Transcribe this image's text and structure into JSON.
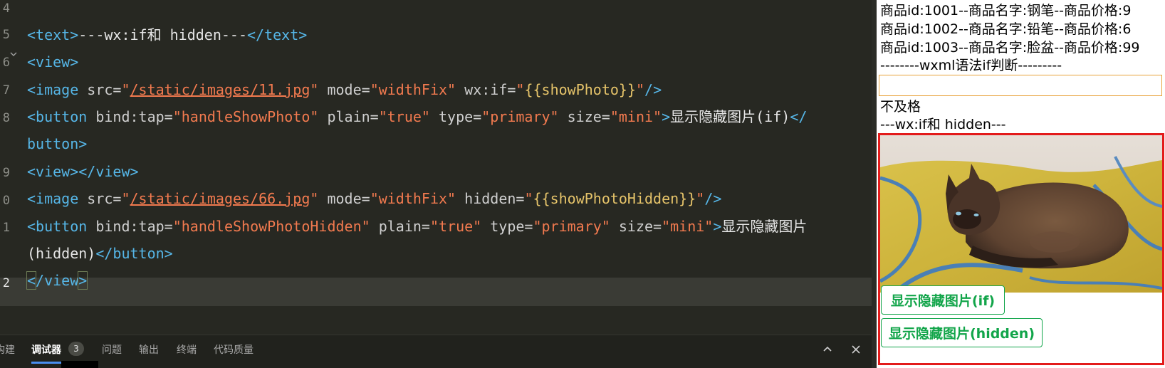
{
  "editor": {
    "gutter_numbers": [
      "4",
      "5",
      "6",
      "7",
      "8",
      "",
      "9",
      "0",
      "1",
      "",
      "2"
    ],
    "lines": [
      {
        "open_bracket": "<",
        "tag": "text",
        "close_bracket": ">",
        "content": "---wx:if和 hidden---",
        "end_tag": "</text>"
      },
      {
        "text": "<view>"
      },
      {
        "tag_open": "<image",
        "attr1": " src=",
        "val1_q": "\"",
        "val1": "/static/images/11.jpg",
        "attr2": " mode=",
        "val2": "\"widthFix\"",
        "attr3": " wx:if=",
        "q": "\"",
        "expr": "{{showPhoto}}",
        "end": "/>"
      },
      {
        "tag_open": "<button",
        "attr1": " bind:tap=",
        "val1": "\"handleShowPhoto\"",
        "attr2": " plain=",
        "val2": "\"true\"",
        "attr3": " type=",
        "val3": "\"primary\"",
        "attr4": " size=",
        "val4": "\"mini\"",
        "gt": ">",
        "content": "显示隐藏图片(if)",
        "end_lt": "</"
      },
      {
        "text": "button>"
      },
      {
        "text": "<view></view>"
      },
      {
        "tag_open": "<image",
        "attr1": " src=",
        "val1": "/static/images/66.jpg",
        "attr2": " mode=",
        "val2": "\"widthFix\"",
        "attr3": " hidden=",
        "expr": "{{showPhotoHidden}}",
        "end": "/>"
      },
      {
        "tag_open": "<button",
        "attr1": " bind:tap=",
        "val1": "\"handleShowPhotoHidden\"",
        "attr2": " plain=",
        "val2": "\"true\"",
        "attr3": " type=",
        "val3": "\"primary\"",
        "attr4": " size=",
        "val4": "\"mini\"",
        "gt": ">",
        "content": "显示隐藏图片"
      },
      {
        "content": "(hidden)",
        "end_tag": "</button>"
      },
      {
        "lt": "<",
        "rest": "/view",
        "gt": ">"
      }
    ]
  },
  "panel": {
    "tabs": [
      "构建",
      "调试器",
      "问题",
      "输出",
      "终端",
      "代码质量"
    ],
    "debugger_badge": "3",
    "collapse_icon": "chevron-up-icon",
    "close_icon": "close-icon"
  },
  "simulator": {
    "goods": [
      "商品id:1001--商品名字:钢笔--商品价格:9",
      "商品id:1002--商品名字:铅笔--商品价格:6",
      "商品id:1003--商品名字:脸盆--商品价格:99"
    ],
    "wxml_if_heading": "--------wxml语法if判断---------",
    "input_value": "",
    "grade_text": "不及格",
    "wx_if_heading": "---wx:if和 hidden---",
    "photo_alt": "cat photo",
    "button_if": "显示隐藏图片(if)",
    "button_hidden": "显示隐藏图片(hidden)"
  },
  "colors": {
    "editor_bg": "#272822",
    "tag": "#56b6e7",
    "string": "#f27a4f",
    "primary_green": "#12a54a",
    "highlight_red": "#e31b1b"
  }
}
